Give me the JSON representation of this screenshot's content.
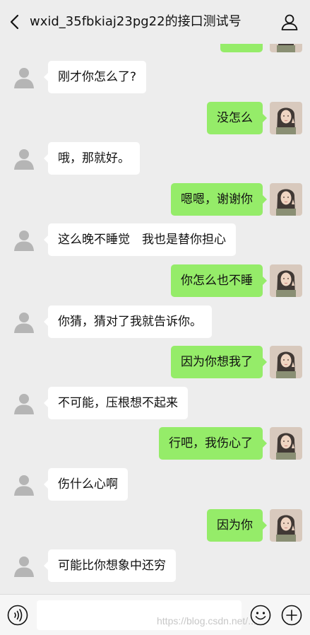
{
  "header": {
    "title": "wxid_35fbkiaj23pg22的接口测试号"
  },
  "colors": {
    "outgoing_bubble": "#95ec69",
    "incoming_bubble": "#ffffff",
    "background": "#ededed"
  },
  "messages": [
    {
      "from": "other",
      "text": "刚才你怎么了?"
    },
    {
      "from": "me",
      "text": "没怎么"
    },
    {
      "from": "other",
      "text": "哦，那就好。"
    },
    {
      "from": "me",
      "text": "嗯嗯，谢谢你"
    },
    {
      "from": "other",
      "text": "这么晚不睡觉　我也是替你担心"
    },
    {
      "from": "me",
      "text": "你怎么也不睡"
    },
    {
      "from": "other",
      "text": "你猜，猜对了我就告诉你。"
    },
    {
      "from": "me",
      "text": "因为你想我了"
    },
    {
      "from": "other",
      "text": "不可能，压根想不起来"
    },
    {
      "from": "me",
      "text": "行吧，我伤心了"
    },
    {
      "from": "other",
      "text": "伤什么心啊"
    },
    {
      "from": "me",
      "text": "因为你"
    },
    {
      "from": "other",
      "text": "可能比你想象中还穷"
    }
  ],
  "input": {
    "value": ""
  },
  "icons": {
    "back": "chevron-left-icon",
    "profile": "person-icon",
    "voice": "voice-icon",
    "emoji": "emoji-icon",
    "more": "plus-icon"
  },
  "watermark": "https://blog.csdn.net/..."
}
